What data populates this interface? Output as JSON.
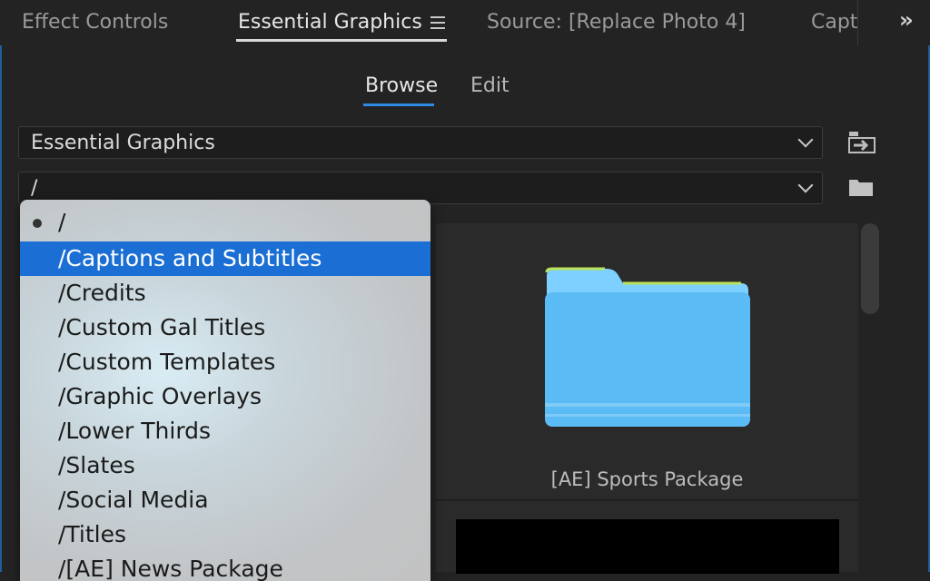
{
  "tabs": [
    {
      "label": "Effect Controls",
      "active": false
    },
    {
      "label": "Essential Graphics",
      "active": true
    },
    {
      "label": "Source: [Replace Photo 4]",
      "active": false
    },
    {
      "label": "Capt",
      "active": false
    }
  ],
  "subtabs": [
    {
      "label": "Browse",
      "active": true
    },
    {
      "label": "Edit",
      "active": false
    }
  ],
  "dropdowns": {
    "library": {
      "value": "Essential Graphics"
    },
    "folder": {
      "value": "/"
    }
  },
  "menu": {
    "items": [
      {
        "label": "/",
        "checked": true
      },
      {
        "label": "/Captions and Subtitles",
        "selected": true
      },
      {
        "label": "/Credits"
      },
      {
        "label": "/Custom Gal Titles"
      },
      {
        "label": "/Custom Templates"
      },
      {
        "label": "/Graphic Overlays"
      },
      {
        "label": "/Lower Thirds"
      },
      {
        "label": "/Slates"
      },
      {
        "label": "/Social Media"
      },
      {
        "label": "/Titles"
      },
      {
        "label": "/[AE] News Package"
      }
    ]
  },
  "grid": {
    "items": [
      {
        "label": "[AE] Sports Package",
        "icon": "folder-icon"
      }
    ]
  },
  "colors": {
    "accent": "#2f8be0",
    "menu_selected": "#1b6fd4",
    "folder": "#5bbcf5"
  }
}
